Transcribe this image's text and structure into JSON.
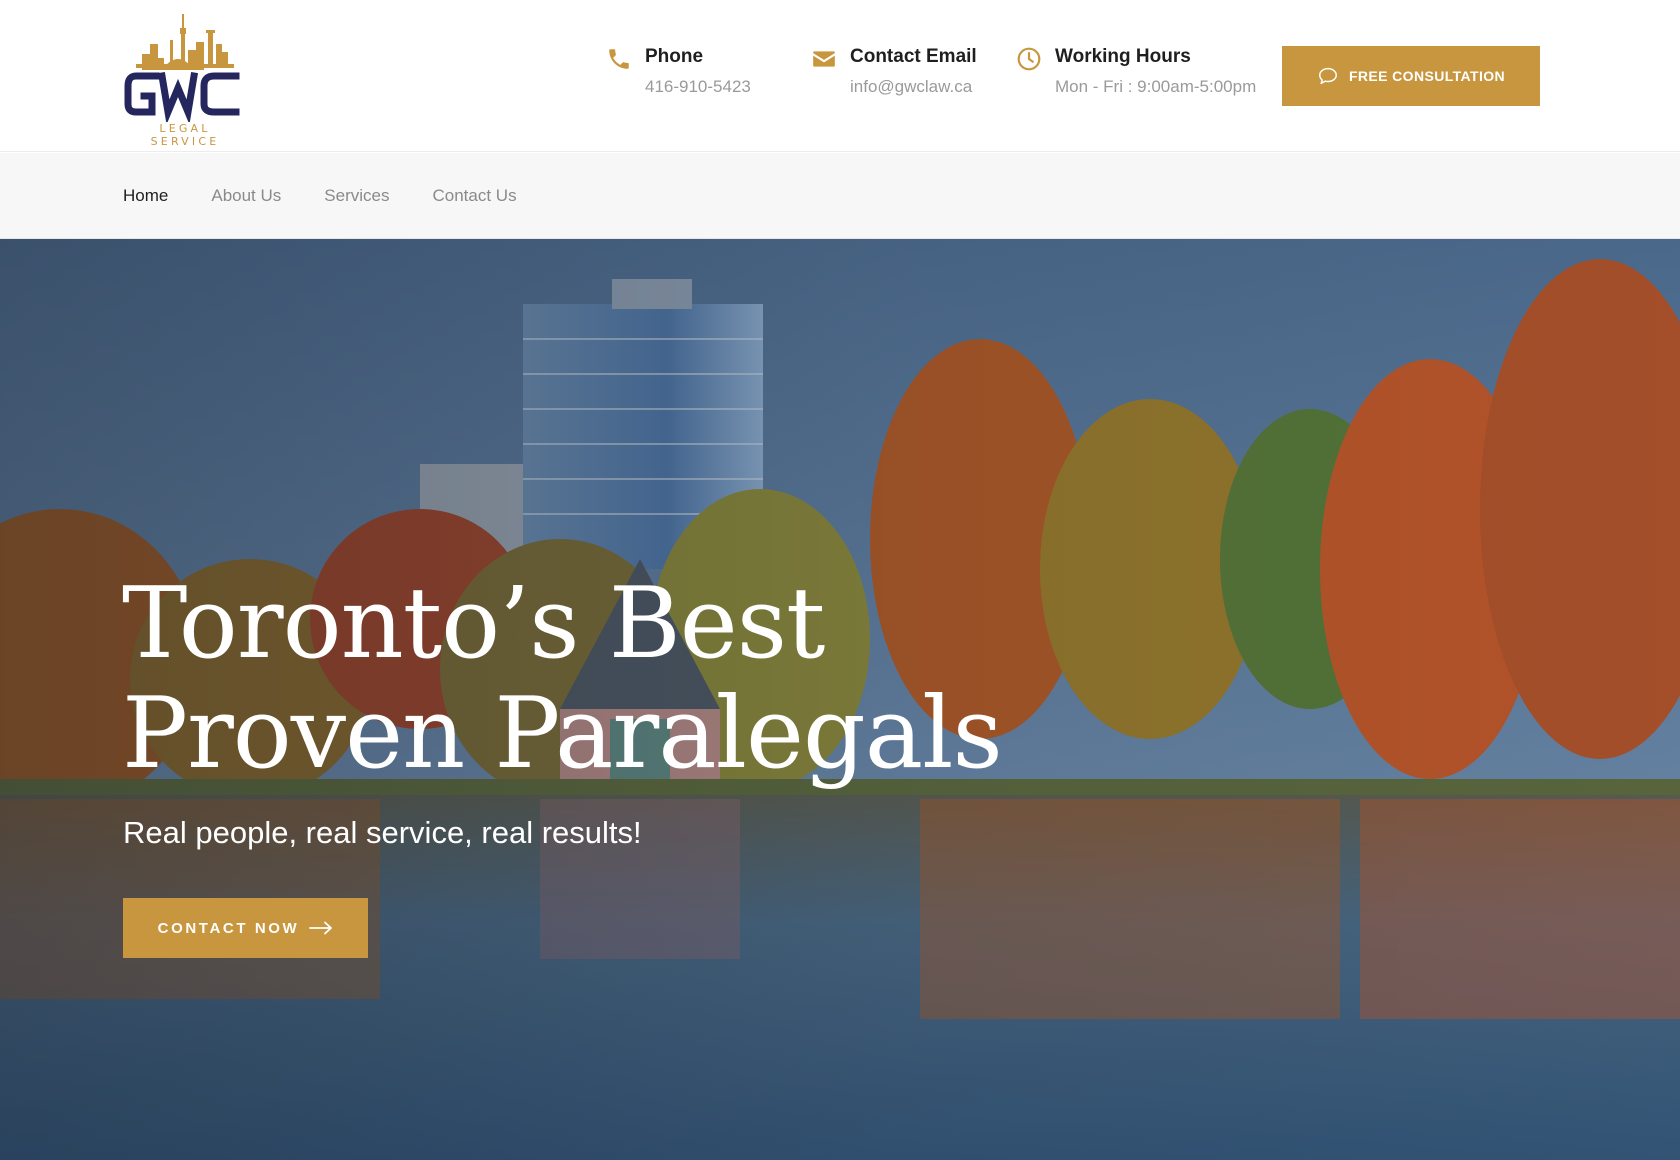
{
  "brand": {
    "logo_letters": "GWC",
    "logo_caption": "LEGAL SERVICE"
  },
  "header": {
    "phone": {
      "title": "Phone",
      "value": "416-910-5423",
      "icon": "phone-icon"
    },
    "email": {
      "title": "Contact Email",
      "value": "info@gwclaw.ca",
      "icon": "envelope-icon"
    },
    "hours": {
      "title": "Working Hours",
      "value": "Mon - Fri : 9:00am-5:00pm",
      "icon": "clock-icon"
    },
    "cta_label": "FREE CONSULTATION",
    "cta_icon": "chat-bubble-icon"
  },
  "nav": {
    "items": [
      {
        "label": "Home",
        "active": true
      },
      {
        "label": "About Us",
        "active": false
      },
      {
        "label": "Services",
        "active": false
      },
      {
        "label": "Contact Us",
        "active": false
      }
    ]
  },
  "hero": {
    "title_line1": "Toronto’s Best",
    "title_line2": "Proven Paralegals",
    "subtitle": "Real people, real service, real results!",
    "cta_label": "CONTACT NOW",
    "cta_icon": "arrow-right-icon"
  },
  "colors": {
    "accent": "#c8963e",
    "logo_navy": "#25265e",
    "text_dark": "#1f1f1f",
    "text_muted": "#9a9a9a",
    "nav_bg": "#f7f7f7"
  }
}
